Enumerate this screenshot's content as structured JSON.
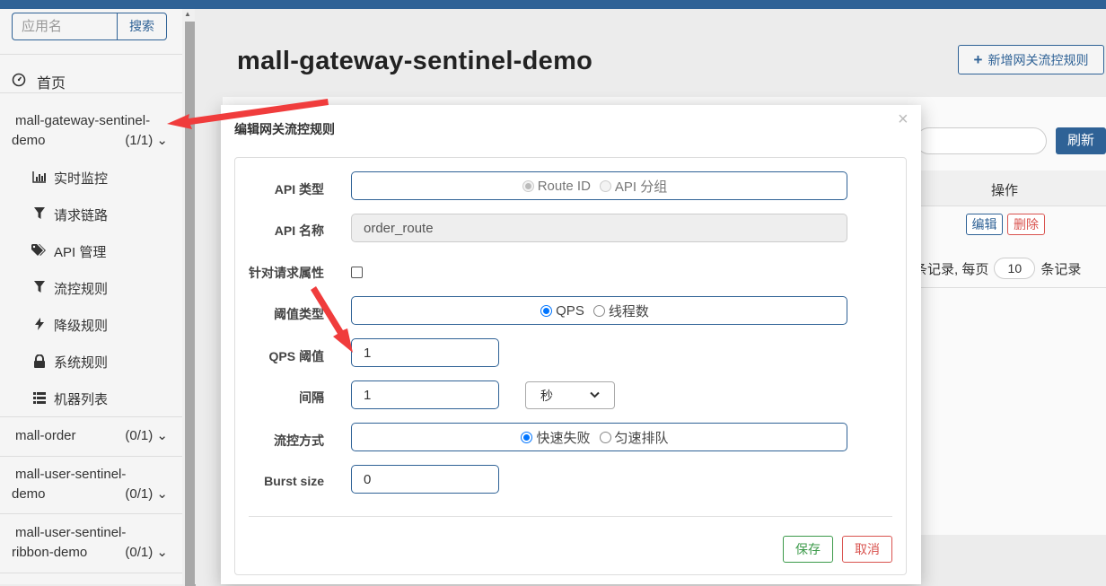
{
  "sidebar": {
    "search_placeholder": "应用名",
    "search_button": "搜索",
    "home_label": "首页",
    "apps": [
      {
        "name_line1": "mall-gateway-sentinel-",
        "name_line2": "demo",
        "count": "(1/1)"
      },
      {
        "name_line1": "mall-order",
        "name_line2": "",
        "count": "(0/1)"
      },
      {
        "name_line1": "mall-user-sentinel-",
        "name_line2": "demo",
        "count": "(0/1)"
      },
      {
        "name_line1": "mall-user-sentinel-",
        "name_line2": "ribbon-demo",
        "count": "(0/1)"
      }
    ],
    "menu": [
      {
        "label": "实时监控",
        "icon": "bar-chart-icon"
      },
      {
        "label": "请求链路",
        "icon": "filter-icon"
      },
      {
        "label": "API 管理",
        "icon": "tags-icon"
      },
      {
        "label": "流控规则",
        "icon": "filter-icon"
      },
      {
        "label": "降级规则",
        "icon": "bolt-icon"
      },
      {
        "label": "系统规则",
        "icon": "lock-icon"
      },
      {
        "label": "机器列表",
        "icon": "list-icon"
      }
    ]
  },
  "main": {
    "title": "mall-gateway-sentinel-demo",
    "add_button": "新增网关流控规则",
    "refresh_button": "刷新",
    "table_header_ops": "操作",
    "edit_button": "编辑",
    "delete_button": "删除",
    "pager_prefix": "条记录, 每页",
    "page_size": "10",
    "pager_suffix": "条记录"
  },
  "dialog": {
    "title": "编辑网关流控规则",
    "api_type_label": "API 类型",
    "api_type_options": [
      "Route ID",
      "API 分组"
    ],
    "api_name_label": "API 名称",
    "api_name_value": "order_route",
    "param_label": "针对请求属性",
    "grade_label": "阈值类型",
    "grade_options": [
      "QPS",
      "线程数"
    ],
    "count_label": "QPS 阈值",
    "count_value": "1",
    "interval_label": "间隔",
    "interval_value": "1",
    "interval_unit": "秒",
    "behavior_label": "流控方式",
    "behavior_options": [
      "快速失败",
      "匀速排队"
    ],
    "burst_label": "Burst size",
    "burst_value": "0",
    "save_button": "保存",
    "cancel_button": "取消"
  },
  "colors": {
    "brand": "#2f6296",
    "danger": "#d9534f",
    "success": "#3c9a4a",
    "arrow": "#f03c3c"
  }
}
